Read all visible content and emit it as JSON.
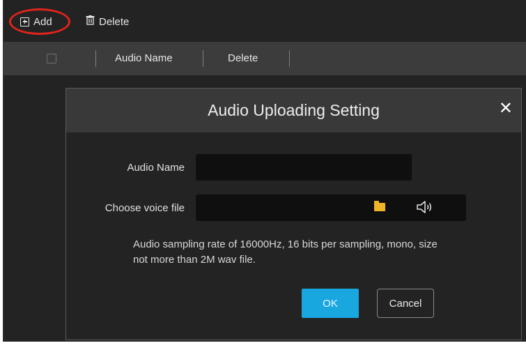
{
  "toolbar": {
    "add_label": "Add",
    "delete_label": "Delete",
    "add_icon": "plus-square-icon",
    "delete_icon": "trash-icon",
    "highlight_color": "#e0241c"
  },
  "table": {
    "columns": [
      "Audio Name",
      "Delete"
    ]
  },
  "dialog": {
    "title": "Audio Uploading Setting",
    "close_glyph": "✕",
    "audio_name_label": "Audio Name",
    "audio_name_value": "",
    "voice_file_label": "Choose voice file",
    "voice_file_value": "",
    "hint": "Audio sampling rate of 16000Hz, 16 bits per sampling, mono, size not more than 2M wav file.",
    "ok_label": "OK",
    "cancel_label": "Cancel",
    "accent_color": "#19a7e0",
    "folder_icon_color": "#f0b429"
  }
}
